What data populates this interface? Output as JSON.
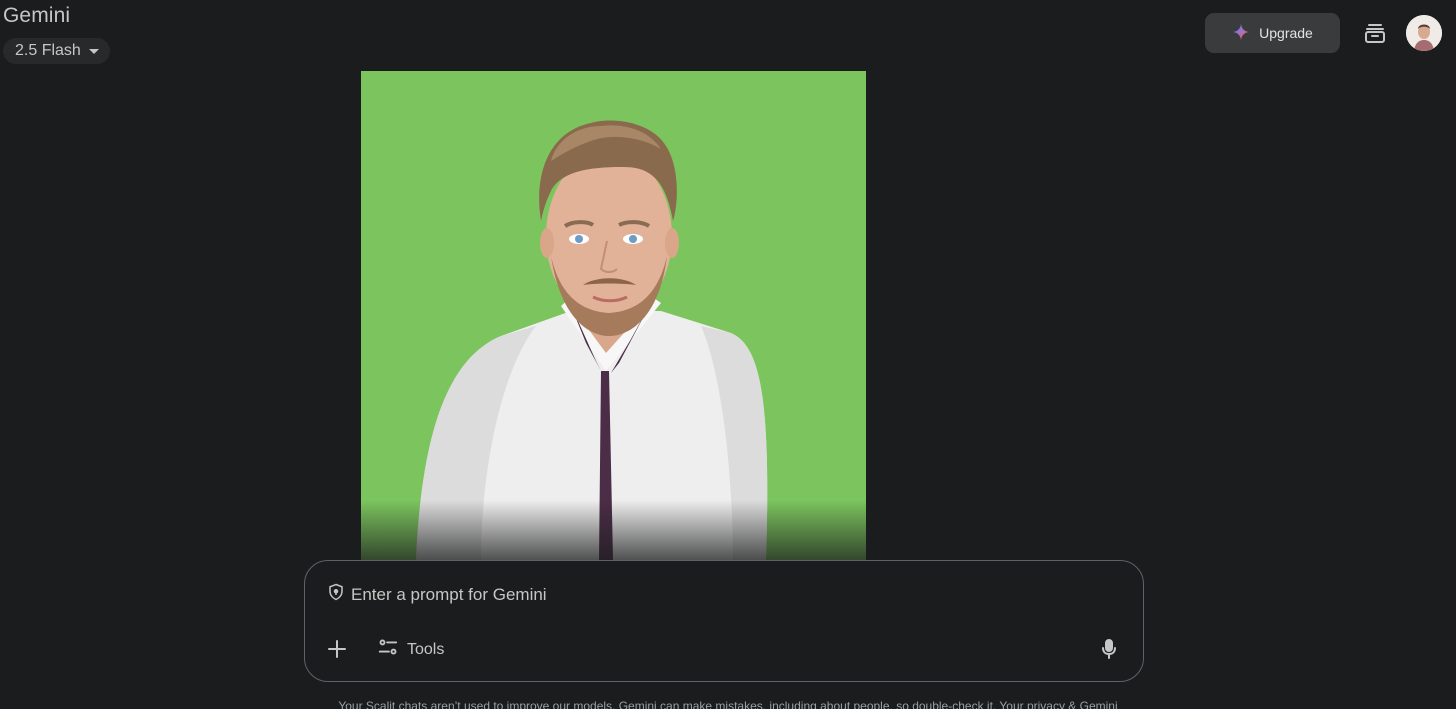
{
  "header": {
    "app_title": "Gemini",
    "model_label": "2.5 Flash",
    "upgrade_label": "Upgrade"
  },
  "icons": {
    "model_caret": "caret-down-icon",
    "upgrade": "sparkle-icon",
    "archive": "archive-icon",
    "shield": "shield-icon",
    "add": "plus-icon",
    "tools": "tools-sliders-icon",
    "mic": "microphone-icon"
  },
  "prompt": {
    "placeholder": "Enter a prompt for Gemini",
    "tools_label": "Tools"
  },
  "footer": {
    "disclaimer": "Your Scalit chats aren’t used to improve our models. Gemini can make mistakes, including about people, so double-check it. Your privacy & Gemini"
  },
  "colors": {
    "background": "#1b1c1d",
    "photo_background": "#7cc55e"
  }
}
